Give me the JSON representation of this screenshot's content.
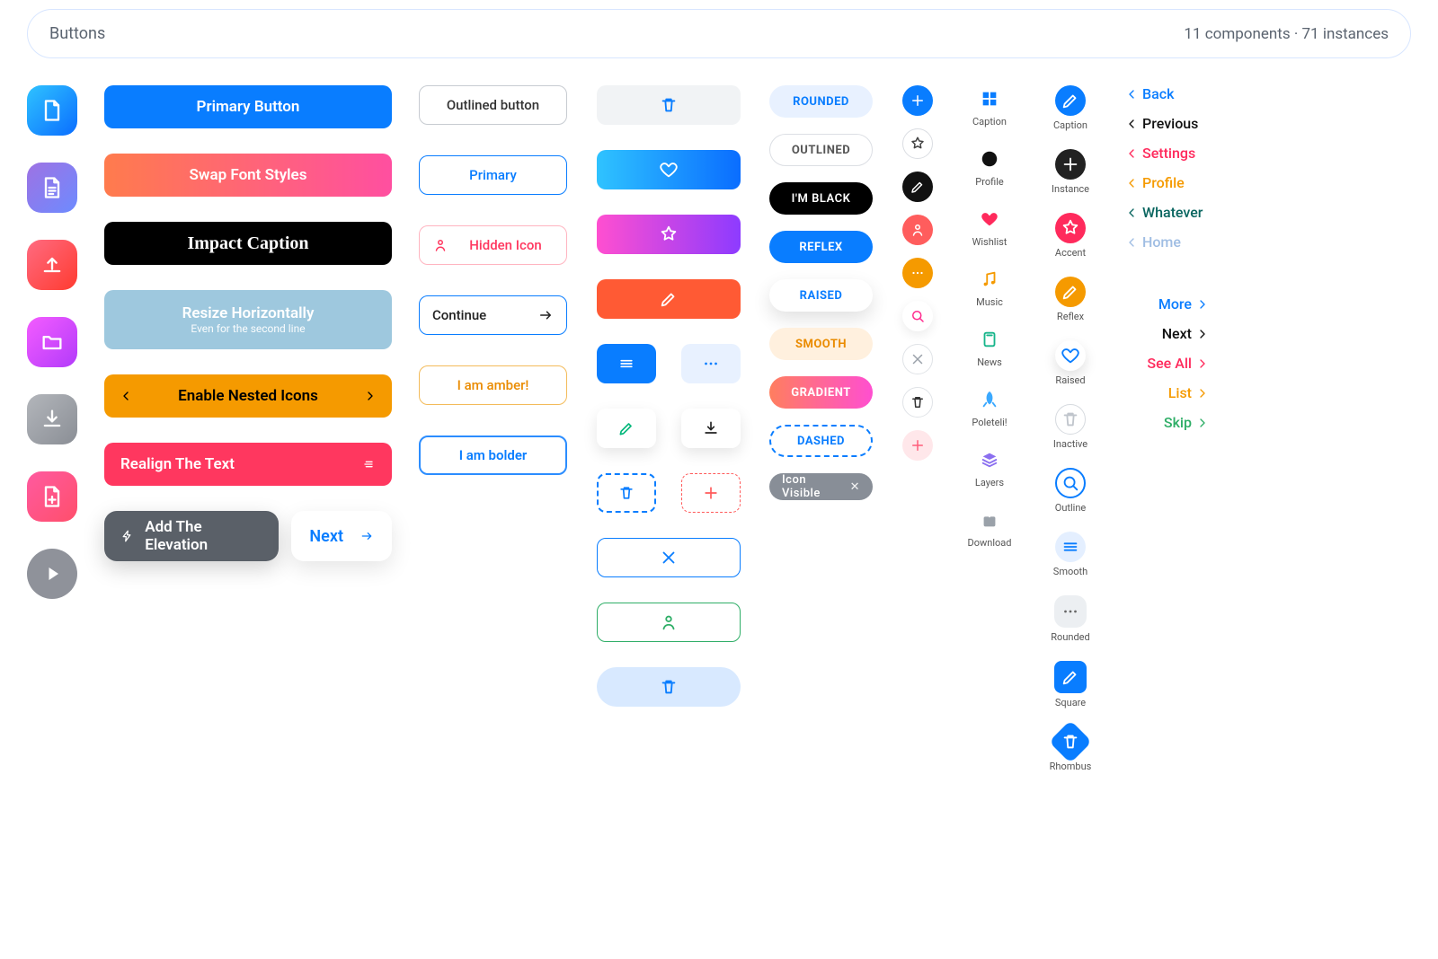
{
  "header": {
    "title": "Buttons",
    "meta": "11 components · 71 instances"
  },
  "col2": {
    "primary": "Primary Button",
    "swap": "Swap Font Styles",
    "impact": "Impact Caption",
    "resize_l1": "Resize Horizontally",
    "resize_l2": "Even for the second line",
    "nested": "Enable Nested Icons",
    "realign": "Realign The Text",
    "elevation": "Add The Elevation",
    "next": "Next"
  },
  "col3": {
    "outlined": "Outlined button",
    "primary": "Primary",
    "hidden": "Hidden Icon",
    "continue": "Continue",
    "amber": "I am amber!",
    "bolder": "I am bolder"
  },
  "col5": {
    "rounded": "ROUNDED",
    "outlined": "OUTLINED",
    "black": "I'M BLACK",
    "reflex": "REFLEX",
    "raised": "RAISED",
    "smooth": "SMOOTH",
    "gradient": "GRADIENT",
    "dashed": "DASHED",
    "chip": "Icon Visible"
  },
  "col7": {
    "caption": "Caption",
    "profile": "Profile",
    "wishlist": "Wishlist",
    "music": "Music",
    "news": "News",
    "poleteli": "Poleteli!",
    "layers": "Layers",
    "download": "Download"
  },
  "col8": {
    "caption": "Caption",
    "instance": "Instance",
    "accent": "Accent",
    "reflex": "Reflex",
    "raised": "Raised",
    "inactive": "Inactive",
    "outline": "Outline",
    "smooth": "Smooth",
    "rounded": "Rounded",
    "square": "Square",
    "rhombus": "Rhombus"
  },
  "col9": {
    "back": "Back",
    "previous": "Previous",
    "settings": "Settings",
    "profile": "Profile",
    "whatever": "Whatever",
    "home": "Home",
    "more": "More",
    "next": "Next",
    "seeall": "See All",
    "list": "List",
    "skip": "Skip"
  }
}
